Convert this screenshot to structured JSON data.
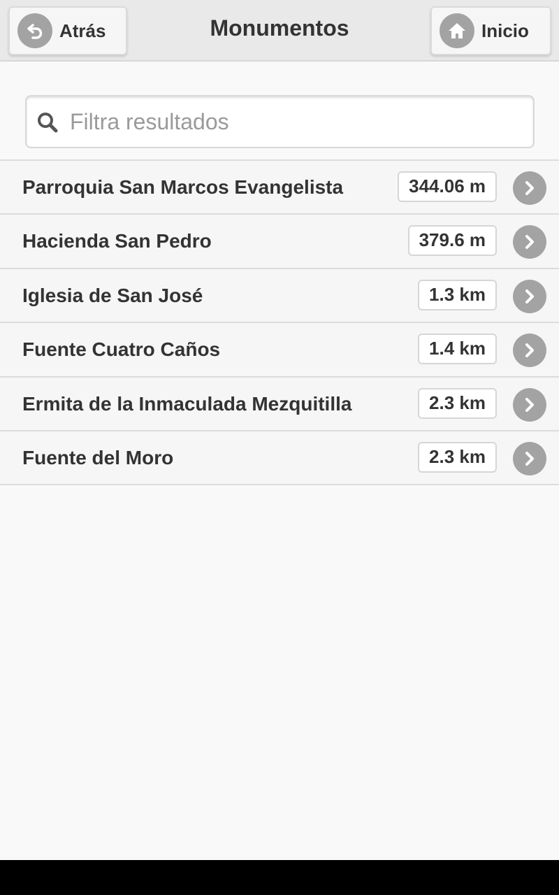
{
  "header": {
    "title": "Monumentos",
    "back_label": "Atrás",
    "back_icon": "back-arrow-icon",
    "home_label": "Inicio",
    "home_icon": "home-icon"
  },
  "search": {
    "placeholder": "Filtra resultados",
    "value": "",
    "icon": "search-icon"
  },
  "items": [
    {
      "name": "Parroquia San Marcos Evangelista",
      "distance": "344.06 m"
    },
    {
      "name": "Hacienda San Pedro",
      "distance": "379.6 m"
    },
    {
      "name": "Iglesia de San José",
      "distance": "1.3 km"
    },
    {
      "name": "Fuente Cuatro Caños",
      "distance": "1.4 km"
    },
    {
      "name": "Ermita de la Inmaculada Mezquitilla",
      "distance": "2.3 km"
    },
    {
      "name": "Fuente del Moro",
      "distance": "2.3 km"
    }
  ],
  "colors": {
    "header_bg": "#e9e9e9",
    "icon_circle": "#a3a3a3",
    "text": "#333333",
    "page_bg": "#f9f9f9"
  }
}
